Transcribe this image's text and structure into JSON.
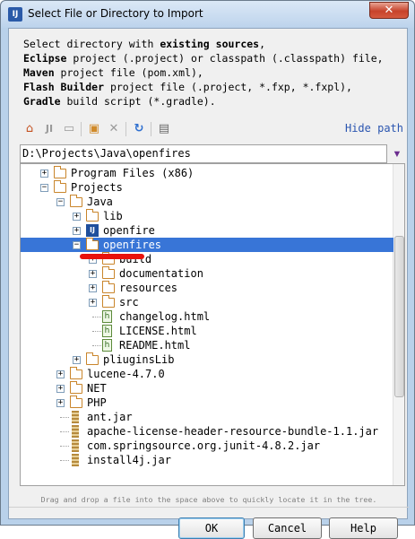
{
  "window": {
    "title": "Select File or Directory to Import",
    "close_label": "✕"
  },
  "description": {
    "line1_pre": "Select directory with ",
    "line1_bold": "existing sources",
    "line1_post": ",",
    "line2_bold": "Eclipse",
    "line2_post": " project (.project) or classpath (.classpath) file,",
    "line3_bold": "Maven",
    "line3_post": " project file (pom.xml),",
    "line4_bold": "Flash Builder",
    "line4_post": " project file (.project, *.fxp, *.fxpl),",
    "line5_bold": "Gradle",
    "line5_post": " build script (*.gradle)."
  },
  "toolbar": {
    "hide_path_label": "Hide path",
    "icons": [
      "home-icon",
      "module-icon",
      "desktop-icon",
      "new-folder-icon",
      "delete-icon",
      "refresh-icon",
      "show-hidden-icon"
    ]
  },
  "path": {
    "value": "D:\\Projects\\Java\\openfires"
  },
  "tree": {
    "items": [
      {
        "label": "Program Files (x86)",
        "type": "folder",
        "depth": 2,
        "expander": "+"
      },
      {
        "label": "Projects",
        "type": "folder",
        "depth": 2,
        "expander": "-"
      },
      {
        "label": "Java",
        "type": "folder",
        "depth": 3,
        "expander": "-"
      },
      {
        "label": "lib",
        "type": "folder",
        "depth": 4,
        "expander": "+"
      },
      {
        "label": "openfire",
        "type": "module",
        "depth": 4,
        "expander": "+"
      },
      {
        "label": "openfires",
        "type": "folder",
        "depth": 4,
        "expander": "-",
        "selected": true
      },
      {
        "label": "build",
        "type": "folder",
        "depth": 5,
        "expander": "+"
      },
      {
        "label": "documentation",
        "type": "folder",
        "depth": 5,
        "expander": "+"
      },
      {
        "label": "resources",
        "type": "folder",
        "depth": 5,
        "expander": "+"
      },
      {
        "label": "src",
        "type": "folder",
        "depth": 5,
        "expander": "+"
      },
      {
        "label": "changelog.html",
        "type": "html",
        "depth": 5,
        "expander": ""
      },
      {
        "label": "LICENSE.html",
        "type": "html",
        "depth": 5,
        "expander": ""
      },
      {
        "label": "README.html",
        "type": "html",
        "depth": 5,
        "expander": ""
      },
      {
        "label": "pliuginsLib",
        "type": "folder",
        "depth": 4,
        "expander": "+"
      },
      {
        "label": "lucene-4.7.0",
        "type": "folder",
        "depth": 3,
        "expander": "+"
      },
      {
        "label": "NET",
        "type": "folder",
        "depth": 3,
        "expander": "+"
      },
      {
        "label": "PHP",
        "type": "folder",
        "depth": 3,
        "expander": "+"
      },
      {
        "label": "ant.jar",
        "type": "jar",
        "depth": 3,
        "expander": ""
      },
      {
        "label": "apache-license-header-resource-bundle-1.1.jar",
        "type": "jar",
        "depth": 3,
        "expander": ""
      },
      {
        "label": "com.springsource.org.junit-4.8.2.jar",
        "type": "jar",
        "depth": 3,
        "expander": ""
      },
      {
        "label": "install4j.jar",
        "type": "jar",
        "depth": 3,
        "expander": ""
      }
    ]
  },
  "hint": "Drag and drop a file into the space above to quickly locate it in the tree.",
  "buttons": {
    "ok": "OK",
    "cancel": "Cancel",
    "help": "Help"
  }
}
